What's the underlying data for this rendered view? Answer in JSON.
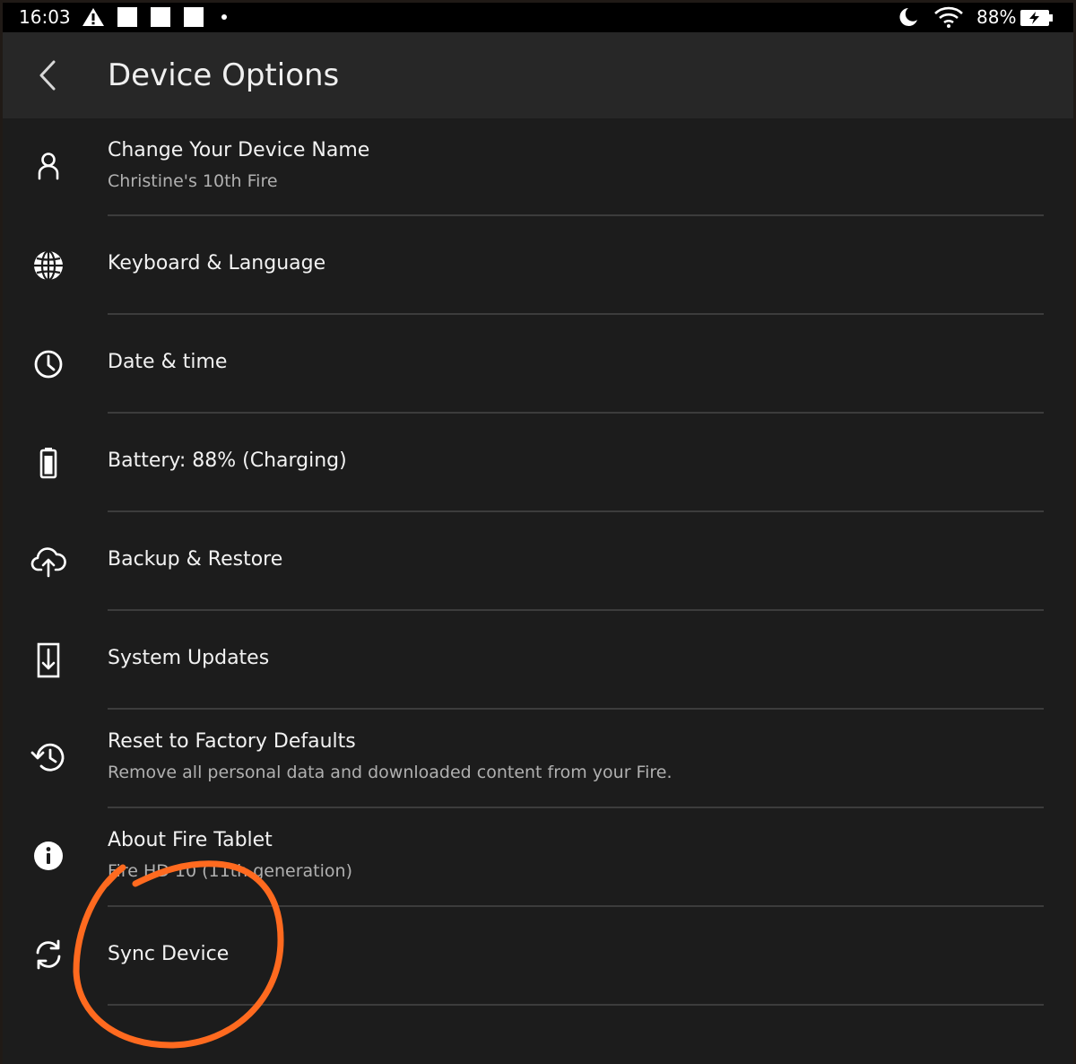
{
  "status_bar": {
    "time": "16:03",
    "battery_percent": "88%",
    "icons": [
      "warning-icon",
      "notification-square-icon",
      "notification-square-icon",
      "notification-square-icon",
      "dot-icon",
      "do-not-disturb-moon-icon",
      "wifi-icon",
      "battery-charging-icon"
    ]
  },
  "header": {
    "title": "Device Options",
    "back_icon": "chevron-left-icon"
  },
  "items": [
    {
      "title": "Change Your Device Name",
      "subtitle": "Christine's 10th Fire",
      "icon": "person-icon"
    },
    {
      "title": "Keyboard & Language",
      "subtitle": "",
      "icon": "globe-icon"
    },
    {
      "title": "Date & time",
      "subtitle": "",
      "icon": "clock-icon"
    },
    {
      "title": "Battery: 88% (Charging)",
      "subtitle": "",
      "icon": "battery-icon"
    },
    {
      "title": "Backup & Restore",
      "subtitle": "",
      "icon": "cloud-upload-icon"
    },
    {
      "title": "System Updates",
      "subtitle": "",
      "icon": "system-update-icon"
    },
    {
      "title": "Reset to Factory Defaults",
      "subtitle": "Remove all personal data and downloaded content from your Fire.",
      "icon": "history-restore-icon"
    },
    {
      "title": "About Fire Tablet",
      "subtitle": "Fire HD 10 (11th generation)",
      "icon": "info-icon"
    },
    {
      "title": "Sync Device",
      "subtitle": "",
      "icon": "sync-icon"
    }
  ],
  "annotation": {
    "shape": "hand-drawn circle highlighting Sync Device",
    "color": "#ff6a1f"
  }
}
